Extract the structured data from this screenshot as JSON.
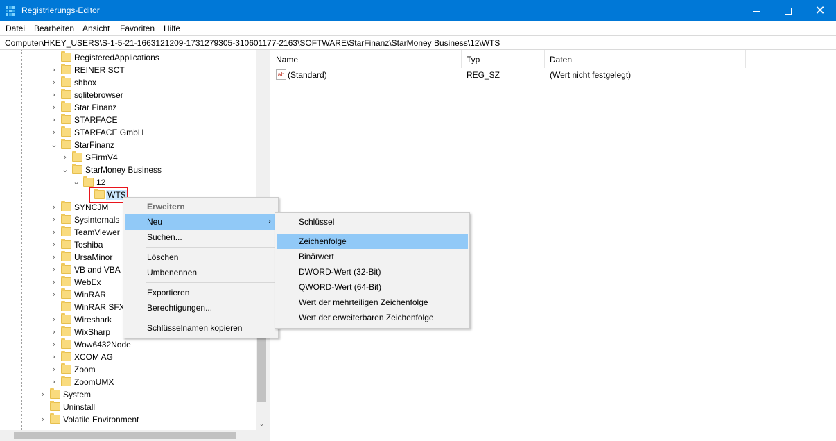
{
  "window": {
    "title": "Registrierungs-Editor",
    "minimize_glyph": "",
    "close_glyph": "✕"
  },
  "menubar": {
    "items": [
      "Datei",
      "Bearbeiten",
      "Ansicht",
      "Favoriten",
      "Hilfe"
    ]
  },
  "address": {
    "path": "Computer\\HKEY_USERS\\S-1-5-21-1663121209-1731279305-310601177-2163\\SOFTWARE\\StarFinanz\\StarMoney Business\\12\\WTS"
  },
  "tree": {
    "nodes": [
      {
        "label": "RegisteredApplications",
        "expander": ""
      },
      {
        "label": "REINER SCT",
        "expander": "›"
      },
      {
        "label": "shbox",
        "expander": "›"
      },
      {
        "label": "sqlitebrowser",
        "expander": "›"
      },
      {
        "label": "Star Finanz",
        "expander": "›"
      },
      {
        "label": "STARFACE",
        "expander": "›"
      },
      {
        "label": "STARFACE GmbH",
        "expander": "›"
      },
      {
        "label": "StarFinanz",
        "expander": "⌄"
      },
      {
        "label": "SFirmV4",
        "expander": "›"
      },
      {
        "label": "StarMoney Business",
        "expander": "⌄"
      },
      {
        "label": "12",
        "expander": "⌄"
      },
      {
        "label": "WTS",
        "expander": ""
      },
      {
        "label": "SYNCJM",
        "expander": "›"
      },
      {
        "label": "Sysinternals",
        "expander": "›"
      },
      {
        "label": "TeamViewer",
        "expander": "›"
      },
      {
        "label": "Toshiba",
        "expander": "›"
      },
      {
        "label": "UrsaMinor",
        "expander": "›"
      },
      {
        "label": "VB and VBA P",
        "expander": "›"
      },
      {
        "label": "WebEx",
        "expander": "›"
      },
      {
        "label": "WinRAR",
        "expander": "›"
      },
      {
        "label": "WinRAR SFX",
        "expander": ""
      },
      {
        "label": "Wireshark",
        "expander": "›"
      },
      {
        "label": "WixSharp",
        "expander": "›"
      },
      {
        "label": "Wow6432Node",
        "expander": "›"
      },
      {
        "label": "XCOM AG",
        "expander": "›"
      },
      {
        "label": "Zoom",
        "expander": "›"
      },
      {
        "label": "ZoomUMX",
        "expander": "›"
      },
      {
        "label": "System",
        "expander": "›"
      },
      {
        "label": "Uninstall",
        "expander": ""
      },
      {
        "label": "Volatile Environment",
        "expander": "›"
      }
    ]
  },
  "values": {
    "headers": {
      "name": "Name",
      "type": "Typ",
      "data": "Daten"
    },
    "rows": [
      {
        "icon": "ab",
        "name": "(Standard)",
        "type": "REG_SZ",
        "data": "(Wert nicht festgelegt)"
      }
    ]
  },
  "context_menu": {
    "items": [
      "Erweitern",
      "Neu",
      "Suchen...",
      "Löschen",
      "Umbenennen",
      "Exportieren",
      "Berechtigungen...",
      "Schlüsselnamen kopieren"
    ],
    "submenu_arrow": "›"
  },
  "submenu_new": {
    "items": [
      "Schlüssel",
      "Zeichenfolge",
      "Binärwert",
      "DWORD-Wert (32-Bit)",
      "QWORD-Wert (64-Bit)",
      "Wert der mehrteiligen Zeichenfolge",
      "Wert der erweiterbaren Zeichenfolge"
    ]
  },
  "scrollbar": {
    "down_arrow": "⌄"
  },
  "colors": {
    "titlebar": "#0078d7",
    "selection": "#cce8ff",
    "menu_highlight": "#91c9f7",
    "highlight_box": "#e8141c",
    "folder": "#f9db7e"
  }
}
